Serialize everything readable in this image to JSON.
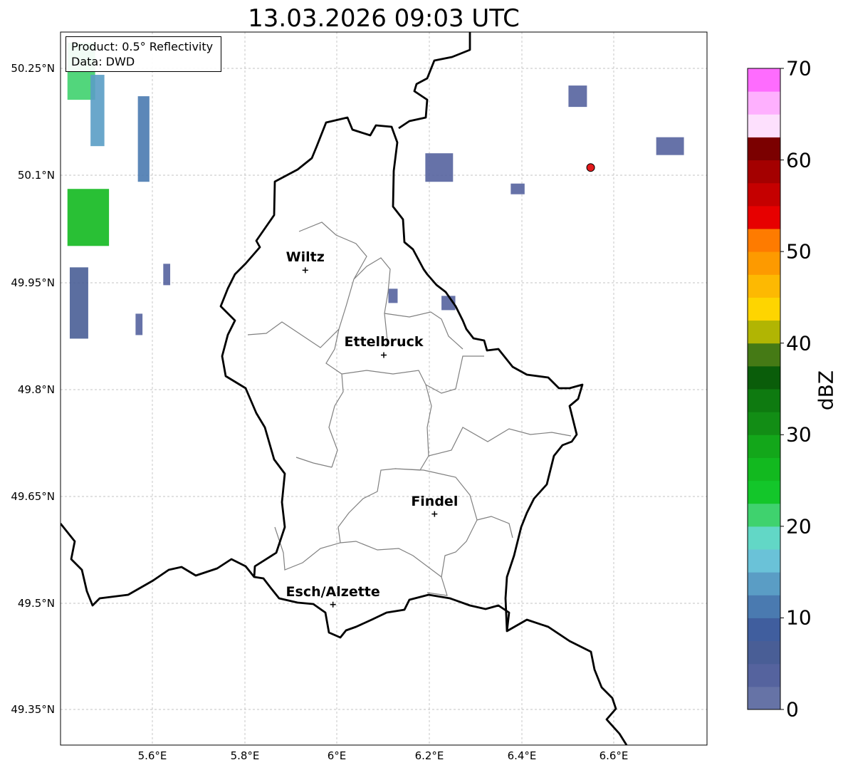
{
  "title": "13.03.2026 09:03 UTC",
  "info": {
    "product": "Product: 0.5° Reflectivity",
    "data": "Data: DWD"
  },
  "lat_ticks": [
    "50.25°N",
    "50.1°N",
    "49.95°N",
    "49.8°N",
    "49.65°N",
    "49.5°N",
    "49.35°N"
  ],
  "lon_ticks": [
    "5.6°E",
    "5.8°E",
    "6°E",
    "6.2°E",
    "6.4°E",
    "6.6°E"
  ],
  "cities": [
    {
      "name": "Wiltz",
      "lon": 5.93,
      "lat": 49.966
    },
    {
      "name": "Ettelbruck",
      "lon": 6.1,
      "lat": 49.847
    },
    {
      "name": "Findel",
      "lon": 6.21,
      "lat": 49.624
    },
    {
      "name": "Esch/Alzette",
      "lon": 5.99,
      "lat": 49.497
    }
  ],
  "radar_site": {
    "lon": 6.548,
    "lat": 50.11,
    "color": "#e31a1c"
  },
  "extent": {
    "lon": [
      5.4,
      6.8
    ],
    "lat": [
      49.3,
      50.3
    ]
  },
  "colorbar": {
    "label": "dBZ",
    "min": 0,
    "max": 70,
    "step": 2.5,
    "tick_labels": [
      "0",
      "10",
      "20",
      "30",
      "40",
      "50",
      "60",
      "70"
    ],
    "colors": [
      "#6673a6",
      "#55639e",
      "#495e96",
      "#405e9e",
      "#4a7ab0",
      "#5a9dc5",
      "#6ac2d8",
      "#62d7c6",
      "#3fd26e",
      "#13c62a",
      "#12b91f",
      "#13a71a",
      "#128d15",
      "#0e7a10",
      "#0a5d0a",
      "#457a15",
      "#b1b503",
      "#fed500",
      "#fdb902",
      "#fd9a00",
      "#fe7b00",
      "#e70000",
      "#c50000",
      "#a40000",
      "#7b0000",
      "#fde0fd",
      "#feb0fe",
      "#fe6cfe",
      "#eb2ff0"
    ]
  },
  "reflectivity_cells": [
    {
      "lon": 5.445,
      "lat": 50.245,
      "dlon": 0.06,
      "dlat": 0.08,
      "dbz": 22
    },
    {
      "lon": 5.48,
      "lat": 50.19,
      "dlon": 0.03,
      "dlat": 0.1,
      "dbz": 14
    },
    {
      "lon": 5.58,
      "lat": 50.15,
      "dlon": 0.025,
      "dlat": 0.12,
      "dbz": 12
    },
    {
      "lon": 5.46,
      "lat": 50.04,
      "dlon": 0.09,
      "dlat": 0.08,
      "dbz": 26
    },
    {
      "lon": 5.44,
      "lat": 49.92,
      "dlon": 0.04,
      "dlat": 0.1,
      "dbz": 6
    },
    {
      "lon": 5.57,
      "lat": 49.89,
      "dlon": 0.015,
      "dlat": 0.03,
      "dbz": 4
    },
    {
      "lon": 5.63,
      "lat": 49.96,
      "dlon": 0.015,
      "dlat": 0.03,
      "dbz": 3
    },
    {
      "lon": 6.22,
      "lat": 50.11,
      "dlon": 0.06,
      "dlat": 0.04,
      "dbz": 3
    },
    {
      "lon": 6.39,
      "lat": 50.08,
      "dlon": 0.03,
      "dlat": 0.015,
      "dbz": 3
    },
    {
      "lon": 6.52,
      "lat": 50.21,
      "dlon": 0.04,
      "dlat": 0.03,
      "dbz": 3
    },
    {
      "lon": 6.72,
      "lat": 50.14,
      "dlon": 0.06,
      "dlat": 0.025,
      "dbz": 3
    },
    {
      "lon": 6.12,
      "lat": 49.93,
      "dlon": 0.02,
      "dlat": 0.02,
      "dbz": 4
    },
    {
      "lon": 6.24,
      "lat": 49.92,
      "dlon": 0.03,
      "dlat": 0.02,
      "dbz": 3
    }
  ]
}
